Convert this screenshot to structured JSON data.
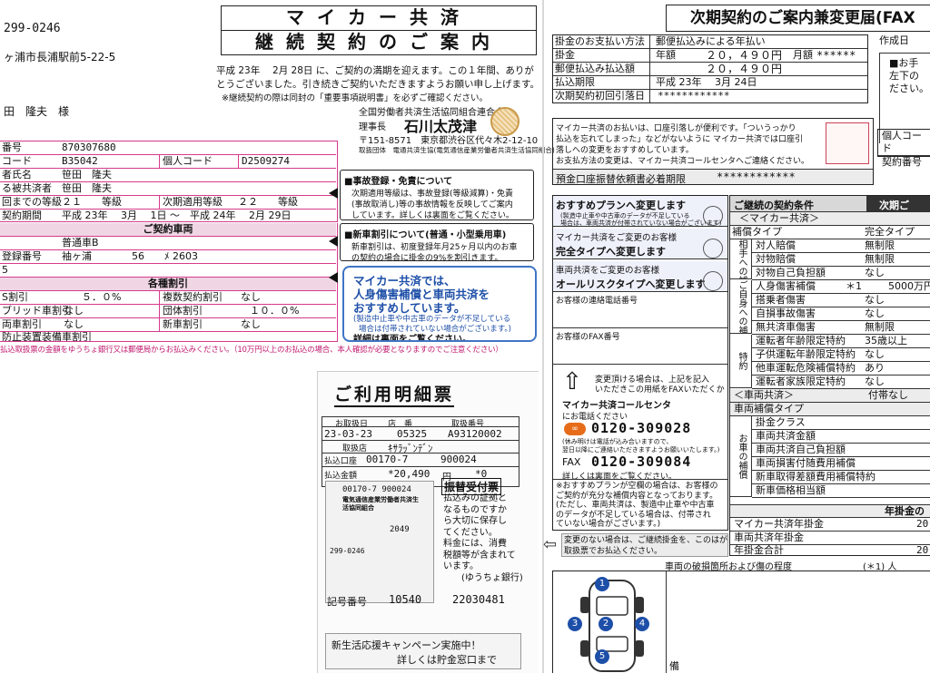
{
  "left": {
    "postal": "299-0246",
    "address": "ヶ浦市長浦駅前5-22-5",
    "name": "田　隆夫　様",
    "rows": [
      {
        "label": "番号",
        "value": "870307680"
      },
      {
        "label": "コード",
        "value": "B35042",
        "label2": "個人コード",
        "value2": "D2509274"
      },
      {
        "label": "者氏名",
        "value": "笹田　隆夫"
      },
      {
        "label": "る被共済者",
        "value": "笹田　隆夫"
      },
      {
        "label": "回までの等級",
        "value": "２１　　等級",
        "label2": "次期適用等級",
        "value2": "２２　　等級"
      },
      {
        "label": "契約期間",
        "value": "平成 23年　 3月 　1日 ～　平成 24年　 2月 29日"
      }
    ],
    "car_header": "ご契約車両",
    "car_rows": [
      {
        "label": "",
        "value": "普通車B"
      },
      {
        "label": "登録番号",
        "value": "袖ヶ浦　　　　56　　ﾒ 2603"
      },
      {
        "label": "5",
        "value": ""
      }
    ],
    "discount_header": "各種割引",
    "disc_rows": [
      {
        "l1": "S割引",
        "v1": "５．０%",
        "l2": "複数契約割引",
        "v2": "なし"
      },
      {
        "l1": "ブリッド車割引",
        "v1": "なし",
        "l2": "団体割引",
        "v2": "１０．０%"
      },
      {
        "l1": "両車割引",
        "v1": "なし",
        "l2": "新車割引",
        "v2": "なし"
      },
      {
        "l1": "防止装置装備車割引",
        "v1": "なし",
        "l2": "",
        "v2": ""
      }
    ],
    "footer_note": "払込取扱票の金額をゆうちょ銀行又は郵便局からお払込みください。（10万円以上のお払込の場合、本人確認が必要となりますのでご注意ください）"
  },
  "center": {
    "title1": "マイカー共済",
    "title2": "継続契約のご案内",
    "intro1": "平成 23年　 2月 28日 に、ご契約の満期を迎えます。この１年間、ありが",
    "intro2": "とうございました。引き続きご契約いただきますようお願い申し上げます。",
    "intro3": "※継続契約の際は同封の「重要事項説明書」を必ずご確認ください。",
    "org": "全国労働者共済生活協同組合連合会",
    "chair_label": "理事長",
    "chair_name": "石川太茂津",
    "address": "〒151-8571　東京都渋谷区代々木2-12-10",
    "agency": "取扱団体　電通共済生協(電気通信産業労働者共済生活協同組合)",
    "accident_title": "■事故登録・免責について",
    "accident_text": [
      "次期適用等級は、事故登録(等級減算)・免責",
      "(事故取消し)等の事故情報を反映してご案内",
      "しています。詳しくは裏面をご覧ください。"
    ],
    "newcar_title": "■新車割引について(普通・小型乗用車)",
    "newcar_text": [
      "新車割引は、初度登録年月25ヶ月以内のお車",
      "の契約の場合に掛金の9%を割引きます。"
    ],
    "promo_title": [
      "マイカー共済では、",
      "人身傷害補償と車両共済を",
      "おすすめしています。"
    ],
    "promo_text": [
      "(製造中止車や中古車のデータが不足している",
      "場合は付帯されていない場合がございます。)"
    ],
    "promo_more": "詳細は裏面をご覧ください。"
  },
  "receipt": {
    "title": "ご利用明細票",
    "h_date": "お取扱日",
    "h_store": "店　番",
    "h_no": "取扱番号",
    "date": "23-03-23",
    "store": "05325",
    "no": "A93120002",
    "h_kind": "取扱店",
    "kind_v": "ｷｻﾗｯﾞﾝﾃﾞﾝ",
    "h_pay": "払込口座",
    "acct1": "00170-7",
    "acct2": "900024",
    "h_amt": "払込金額",
    "amt": "*20,490",
    "amt_suffix": "円",
    "star0": "*0",
    "stamp_title": "振替受付票",
    "stamp_text": [
      "払込みの証拠と",
      "なるものですか",
      "ら大切に保存し",
      "てください。",
      "料金には、消費",
      "税額等が含まれて",
      "います。",
      "(ゆうちょ銀行)"
    ],
    "slip_acct": "00170-7 900024",
    "slip_name": "電気通信産業労働者共済生活協同組合",
    "slip_amt": "2049",
    "slip_postal": "299-0246",
    "reg_label": "記号番号",
    "reg_no": "10540",
    "reg_no2": "22030481",
    "campaign1": "新生活応援キャンペーン実施中！",
    "campaign2": "詳しくは貯金窓口まで"
  },
  "right": {
    "title": "次期契約のご案内兼変更届(FAX",
    "create_date": "作成日",
    "pay_method_label": "掛金のお支払い方法",
    "pay_method_value": "郵便払込みによる年払い",
    "premium_label": "掛金",
    "premium_kind": "年額",
    "premium_value": "２０，４９０円",
    "monthly_label": "月額",
    "monthly_value": "******",
    "postal_label": "郵便払込み払込額",
    "postal_value": "２０，４９０円",
    "due_label": "払込期限",
    "due_value": "平成 23年　 3月 24日",
    "transfer_label": "次期契約初回引落日",
    "transfer_value": "************",
    "bank_text": [
      "マイカー共済のお払いは、口座引落しが便利です。「ついうっかり",
      "払込を忘れてしまった」などがないように マイカー共済では口座引",
      "落しへの変更をおすすめしています。",
      "お支払方法の変更は、マイカー共済コールセンタへご連絡ください。"
    ],
    "bank_label": "預金口座振替依頼書必着期限",
    "bank_value": "************",
    "side_right": [
      "■お手",
      "左下の",
      "ださい。"
    ],
    "side_pc": "個人コード",
    "side_no": "契約番号",
    "plan_title": "おすすめプランへ変更します",
    "plan_note": [
      "(製造中止車や中古車のデータが不足している",
      "場合は、車両共済が付帯されていない場合がございます)"
    ],
    "full_label": "マイカー共済をご変更のお客様",
    "full_value": "完全タイプへ変更します",
    "allrisk_label": "車両共済をご変更のお客様",
    "allrisk_value": "オールリスクタイプへ変更します",
    "contact_label": "お客様の連絡電話番号",
    "fax_label": "お客様のFAX番号",
    "arrow_text": [
      "変更頂ける場合は、上記を記入",
      "いただきこの用紙をFAXいただくか"
    ],
    "call_label": "マイカー共済コールセンタ",
    "call_sub": "にお電話ください",
    "free_num": "0120-309028",
    "free_note": [
      "(休み明けは電話が込み合いますので、",
      "翌日以降にご連絡いただきますようお願いいたします。)"
    ],
    "fax_prefix": "FAX",
    "fax_num": "0120-309084",
    "fax_note": "詳しくは裏面をご覧ください。",
    "rec_text": [
      "※おすすめプランが空欄の場合は、お客様の",
      "ご契約が充分な補償内容となっております。",
      "(ただし、車両共済は、製造中止車や中古車",
      "のデータが不足している場合は、付帯され",
      "ていない場合がございます。)"
    ],
    "bottom_note": [
      "変更のない場合は、ご継続掛金を、このはがきの払",
      "取扱票でお払込ください。"
    ],
    "damage_label": "車両の破損箇所および傷の程度",
    "cond_header": "ご継続の契約条件",
    "next_header": "次期ご",
    "mycar_section": "＜マイカー共済＞",
    "cov_type_label": "補償タイプ",
    "cov_type_value": "完全タイプ",
    "side_labels": {
      "aite": "相手への補償",
      "jibun": "ご自身への補償",
      "tokuyaku": "特約",
      "sharyo": "お車の補償"
    },
    "coverages": [
      {
        "label": "対人賠償",
        "value": "無制限"
      },
      {
        "label": "対物賠償",
        "value": "無制限"
      },
      {
        "label": "対物自己負担額",
        "value": "なし"
      },
      {
        "label": "人身傷害補償　　　＊1",
        "value": "5000万円"
      },
      {
        "label": "搭乗者傷害",
        "value": "なし"
      },
      {
        "label": "自損事故傷害",
        "value": "なし"
      },
      {
        "label": "無共済車傷害",
        "value": "無制限"
      },
      {
        "label": "運転者年齢限定特約",
        "value": "35歳以上"
      },
      {
        "label": "子供運転年齢限定特約",
        "value": "なし"
      },
      {
        "label": "他車運転危険補償特約",
        "value": "あり"
      },
      {
        "label": "運転者家族限定特約",
        "value": "なし"
      }
    ],
    "car_section": "＜車両共済＞",
    "car_section_value": "付帯なし",
    "car_cov_type": "車両補償タイプ",
    "car_rows": [
      "掛金クラス",
      "車両共済金額",
      "車両共済自己負担額",
      "車両損害付随費用補償",
      "新車取得差額費用補償特約",
      "新車価格相当額"
    ],
    "annual_header": "年掛金の",
    "sum_rows": [
      {
        "label": "マイカー共済年掛金",
        "value": "20"
      },
      {
        "label": "車両共済年掛金",
        "value": ""
      },
      {
        "label": "年掛金合計",
        "value": "20"
      }
    ],
    "note1": "(＊1) 人",
    "corner": "備"
  }
}
